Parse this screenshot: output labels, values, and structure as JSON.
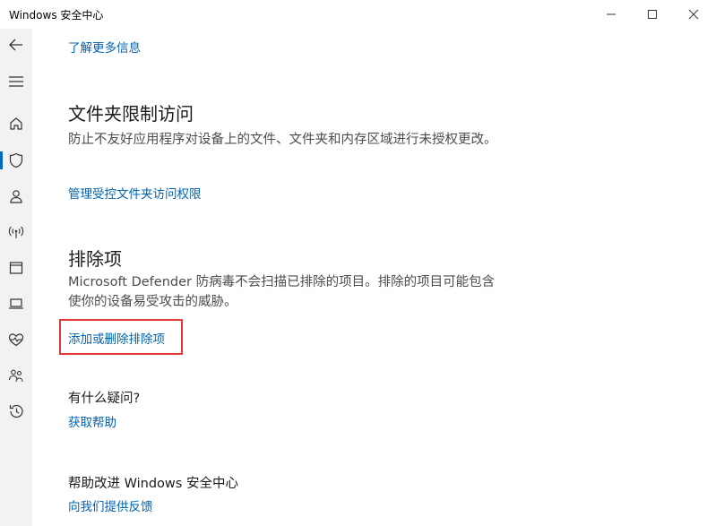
{
  "window": {
    "title": "Windows 安全中心"
  },
  "sidebar": {
    "items": [
      {
        "icon": "back-arrow-icon"
      },
      {
        "icon": "menu-icon"
      },
      {
        "icon": "home-icon"
      },
      {
        "icon": "shield-icon",
        "active": true
      },
      {
        "icon": "person-icon"
      },
      {
        "icon": "wireless-icon"
      },
      {
        "icon": "app-window-icon"
      },
      {
        "icon": "laptop-icon"
      },
      {
        "icon": "heart-pulse-icon"
      },
      {
        "icon": "family-icon"
      },
      {
        "icon": "history-icon"
      }
    ]
  },
  "content": {
    "learn_more_link": "了解更多信息",
    "folder_access": {
      "title": "文件夹限制访问",
      "description": "防止不友好应用程序对设备上的文件、文件夹和内存区域进行未授权更改。",
      "manage_link": "管理受控文件夹访问权限"
    },
    "exclusions": {
      "title": "排除项",
      "description": "Microsoft Defender 防病毒不会扫描已排除的项目。排除的项目可能包含使你的设备易受攻击的威胁。",
      "add_remove_link": "添加或删除排除项"
    },
    "questions": {
      "title": "有什么疑问?",
      "help_link": "获取帮助"
    },
    "improve": {
      "title": "帮助改进 Windows 安全中心",
      "feedback_link": "向我们提供反馈"
    }
  },
  "colors": {
    "link": "#0063b1",
    "highlight": "#e23a3a",
    "sidebar_bg": "#f2f2f2"
  }
}
